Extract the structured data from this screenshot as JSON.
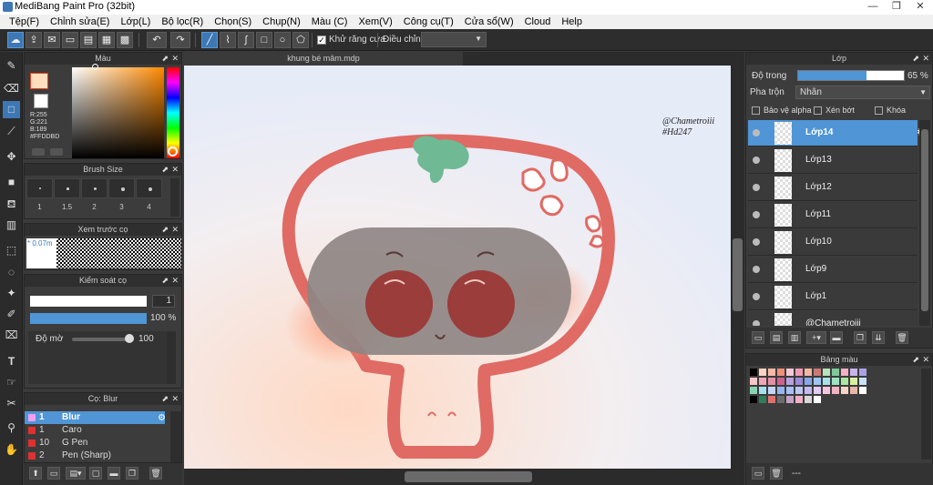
{
  "app": {
    "title": "MediBang Paint Pro (32bit)"
  },
  "window": {
    "minimize": "—",
    "restore": "❐",
    "close": "✕"
  },
  "menu": [
    "Tệp(F)",
    "Chỉnh sửa(E)",
    "Lớp(L)",
    "Bộ lọc(R)",
    "Chọn(S)",
    "Chụp(N)",
    "Màu (C)",
    "Xem(V)",
    "Công cụ(T)",
    "Cửa sổ(W)",
    "Cloud",
    "Help"
  ],
  "toolbar": {
    "antialias_label": "Khử răng cưa",
    "adjust_label": "Điều chỉnh",
    "adjust_value": ""
  },
  "color_panel": {
    "title": "Màu",
    "r": "R:255",
    "g": "G:221",
    "b": "B:189",
    "hex": "#FFDDBD",
    "fg_color": "#ffddbd",
    "bg_color": "#ffffff"
  },
  "brush_size": {
    "title": "Brush Size",
    "sizes": [
      "1",
      "1.5",
      "2",
      "3",
      "4"
    ]
  },
  "brush_preview": {
    "title": "Xem trước cọ",
    "size_label": "0.07m"
  },
  "brush_control": {
    "title": "Kiểm soát cọ",
    "size_value": "1",
    "opacity_value": "100 %",
    "blur_label": "Độ mờ",
    "blur_value": "100"
  },
  "brush_list": {
    "title": "Cọ: Blur",
    "items": [
      {
        "n": "1",
        "name": "Blur",
        "color": "#f0a0f0"
      },
      {
        "n": "1",
        "name": "Caro",
        "color": "#e03030"
      },
      {
        "n": "10",
        "name": "G Pen",
        "color": "#e03030"
      },
      {
        "n": "2",
        "name": "Pen (Sharp)",
        "color": "#e03030"
      }
    ]
  },
  "document": {
    "tab": "khung bé mâm.mdp"
  },
  "artwork": {
    "signature_line1": "@Chametroiii",
    "signature_line2": "#Hd247"
  },
  "layer_panel": {
    "title": "Lớp",
    "opacity_label": "Độ trong",
    "opacity_value": "65 %",
    "opacity_level": 0.65,
    "blend_label": "Pha trộn",
    "blend_value": "Nhân",
    "protect_alpha": "Bảo vệ alpha",
    "clipping": "Xén bớt",
    "lock": "Khóa",
    "layers": [
      "Lớp14",
      "Lớp13",
      "Lớp12",
      "Lớp11",
      "Lớp10",
      "Lớp9",
      "Lớp1",
      "@Chametroiii"
    ]
  },
  "palette_panel": {
    "title": "Bảng màu",
    "footer": "---",
    "colors": [
      "#000000",
      "#fbd3c4",
      "#f7b8a6",
      "#ef8f7a",
      "#f4c8d4",
      "#ef9ab4",
      "#f2b7a2",
      "#c97a74",
      "#b8e2b9",
      "#7fc89a",
      "#f6b0c3",
      "#c7b4e8",
      "#a9a3e6",
      "#f6c7c8",
      "#f3a5b8",
      "#e68fa8",
      "#d06090",
      "#b8a2e0",
      "#9c8bd8",
      "#86a7e9",
      "#9ec6f2",
      "#a6e3e8",
      "#9ce1c2",
      "#a8e8a3",
      "#d8f0a0",
      "#c9e2f8",
      "#8bd3b4",
      "#a5e0f0",
      "#c2d7f7",
      "#98b4ee",
      "#a8c0f5",
      "#bfc6ef",
      "#c4b9f2",
      "#e0ccf4",
      "#f4c5e0",
      "#f3b4c4",
      "#f7d6c8",
      "#e7b7a8",
      "#ffffff",
      "#000000",
      "#2e7d5b",
      "#e07070",
      "#6d6d6d",
      "#c7a2c8",
      "#f0b0c8",
      "#d8d8d8",
      "#ffffff"
    ]
  }
}
